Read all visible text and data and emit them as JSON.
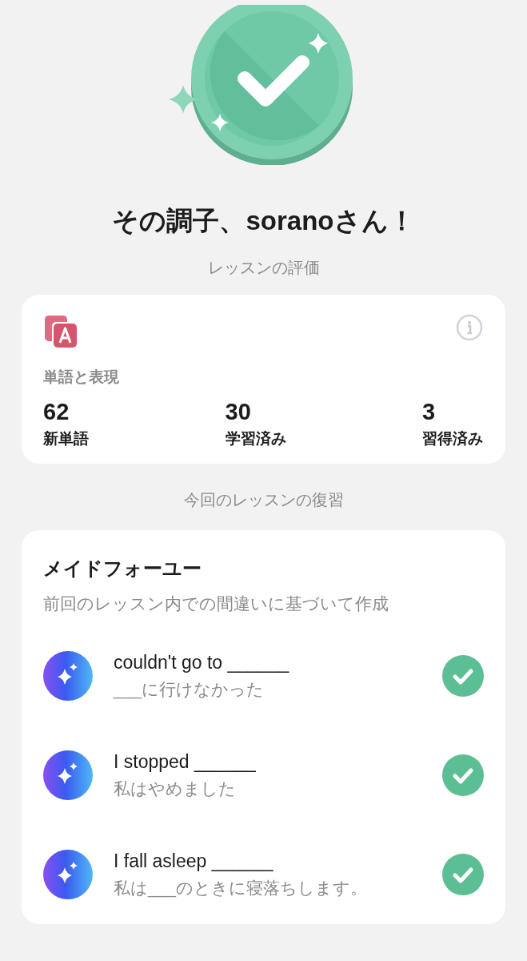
{
  "heading": "その調子、soranoさん！",
  "rating_label": "レッスンの評価",
  "vocab_card": {
    "title": "単語と表現",
    "stats": [
      {
        "value": "62",
        "label": "新単語"
      },
      {
        "value": "30",
        "label": "学習済み"
      },
      {
        "value": "3",
        "label": "習得済み"
      }
    ]
  },
  "review_label": "今回のレッスンの復習",
  "review_card": {
    "title": "メイドフォーユー",
    "subtitle": "前回のレッスン内での間違いに基づいて作成",
    "items": [
      {
        "phrase": "couldn't go to ______",
        "translation": "___に行けなかった",
        "done": true
      },
      {
        "phrase": "I stopped ______",
        "translation": "私はやめました",
        "done": true
      },
      {
        "phrase": "I fall asleep ______",
        "translation": "私は___のときに寝落ちします。",
        "done": true
      }
    ]
  }
}
